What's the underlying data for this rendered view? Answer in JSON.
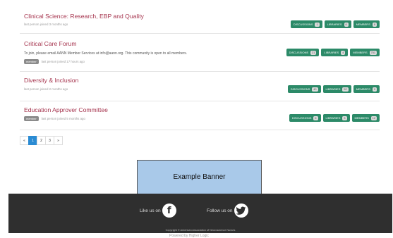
{
  "communities": [
    {
      "title": "Clinical Science: Research, EBP and Quality",
      "desc": "",
      "member": false,
      "joined": "last person joined 3 months ago",
      "discussions": "1",
      "libraries": "6",
      "members": "8"
    },
    {
      "title": "Critical Care Forum",
      "desc": "To join, please email AANN Member Services at info@aann.org. This community is open to all members.",
      "member": true,
      "joined": "last person joined 17 hours ago",
      "discussions": "21",
      "libraries": "4",
      "members": "751"
    },
    {
      "title": "Diversity & Inclusion",
      "desc": "",
      "member": false,
      "joined": "last person joined 2 months ago",
      "discussions": "40",
      "libraries": "52",
      "members": "9"
    },
    {
      "title": "Education Approver Committee",
      "desc": "",
      "member": true,
      "joined": "last person joined 5 months ago",
      "discussions": "6",
      "libraries": "3",
      "members": "12"
    }
  ],
  "labels": {
    "member_badge": "member",
    "discussions": "DISCUSSIONS",
    "libraries": "LIBRARIES",
    "members": "MEMBERS"
  },
  "pager": {
    "prev": "«",
    "pages": [
      "1",
      "2",
      "3"
    ],
    "next": "»",
    "current": "1"
  },
  "banner": {
    "text": "Example Banner"
  },
  "footer": {
    "like": "Like us on",
    "follow": "Follow us on",
    "copyright": "Copyright © American Association of Neuroscience Nurses"
  },
  "powered": "Powered by Higher Logic",
  "colors": {
    "title": "#a5334d",
    "button": "#2c8a68",
    "active_page": "#2a8bd3",
    "banner": "#a9c9e9",
    "footer": "#2f2f2f"
  }
}
